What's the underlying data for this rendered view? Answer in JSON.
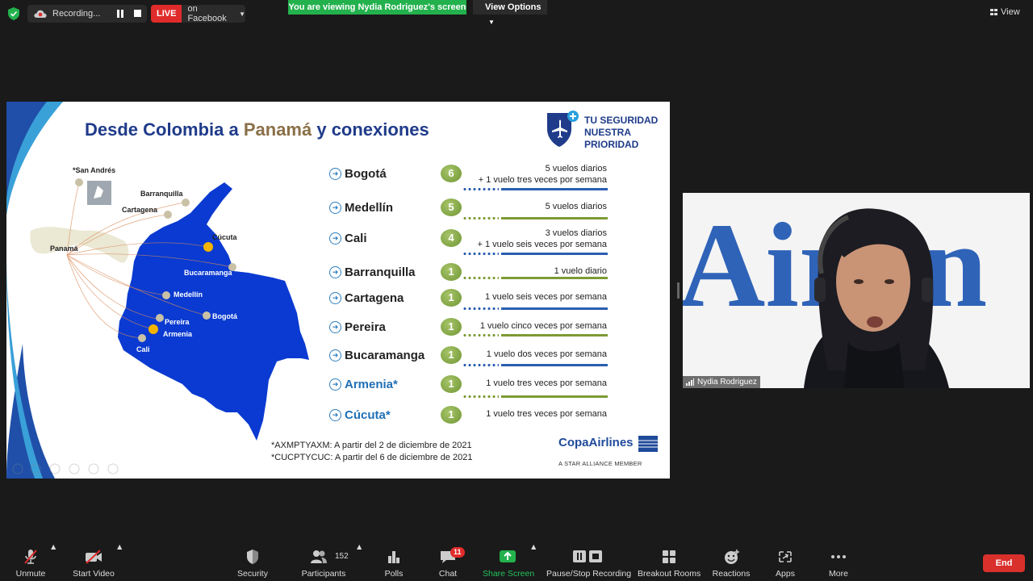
{
  "topbar": {
    "recording_label": "Recording...",
    "live_label": "LIVE",
    "live_destination": "on Facebook",
    "viewing_banner": "You are viewing Nydia Rodriguez's screen",
    "view_options_label": "View Options",
    "view_label": "View"
  },
  "slide": {
    "title_part1": "Desde Colombia a ",
    "title_part2": "Panamá",
    "title_part3": " y conexiones",
    "badge_lines": [
      "TU SEGURIDAD",
      "NUESTRA",
      "PRIORIDAD"
    ],
    "map_labels": {
      "san_andres": "*San Andrés",
      "barranquilla": "Barranquilla",
      "cartagena": "Cartagena",
      "cucuta": "Cúcuta",
      "panama": "Panamá",
      "bucaramanga": "Bucaramanga",
      "medellin": "Medellín",
      "bogota": "Bogotá",
      "pereira": "Pereira",
      "armenia": "Armenia",
      "cali": "Cali"
    },
    "routes": [
      {
        "city": "Bogotá",
        "count": "6",
        "freq": "5 vuelos diarios\n+ 1 vuelo tres veces por semana",
        "line": "blue"
      },
      {
        "city": "Medellín",
        "count": "5",
        "freq": "5 vuelos diarios",
        "line": "green"
      },
      {
        "city": "Cali",
        "count": "4",
        "freq": "3 vuelos diarios\n+ 1 vuelo seis veces por semana",
        "line": "blue"
      },
      {
        "city": "Barranquilla",
        "count": "1",
        "freq": "1 vuelo diario",
        "line": "green"
      },
      {
        "city": "Cartagena",
        "count": "1",
        "freq": "1 vuelo seis veces por semana",
        "line": "blue"
      },
      {
        "city": "Pereira",
        "count": "1",
        "freq": "1 vuelo cinco veces por semana",
        "line": "green"
      },
      {
        "city": "Bucaramanga",
        "count": "1",
        "freq": "1 vuelo dos veces por semana",
        "line": "blue"
      },
      {
        "city": "Armenia*",
        "count": "1",
        "freq": "1 vuelo tres veces por semana",
        "line": "green"
      },
      {
        "city": "Cúcuta*",
        "count": "1",
        "freq": "1 vuelo tres veces por semana",
        "line": ""
      }
    ],
    "footnotes": [
      "*AXMPTYAXM: A partir del 2 de diciembre de 2021",
      "*CUCPTYCUC: A partir del 6 de diciembre de 2021"
    ],
    "brand_name": "CopaAirlines",
    "brand_sub": "A STAR ALLIANCE MEMBER"
  },
  "video": {
    "participant_name": "Nydia Rodriguez",
    "background_text": "Airlin"
  },
  "toolbar": {
    "unmute": "Unmute",
    "start_video": "Start Video",
    "security": "Security",
    "participants": "Participants",
    "participants_count": "152",
    "polls": "Polls",
    "chat": "Chat",
    "chat_badge": "11",
    "share_screen": "Share Screen",
    "pause_stop_recording": "Pause/Stop Recording",
    "breakout_rooms": "Breakout Rooms",
    "reactions": "Reactions",
    "apps": "Apps",
    "more": "More",
    "end": "End"
  },
  "colors": {
    "live_red": "#e02b2b",
    "zoom_green": "#23b14d",
    "slide_blue": "#1f3b8a",
    "route_green": "#7d9b35"
  }
}
